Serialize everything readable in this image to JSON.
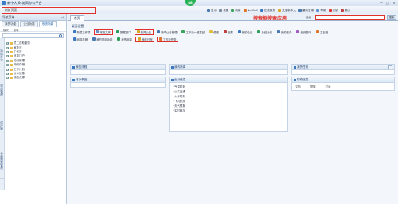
{
  "window": {
    "title": "新中大i6s协同办公平台",
    "badge": "48",
    "controls": [
      "—",
      "□",
      "×"
    ]
  },
  "top_hint": "刷新页面",
  "toolbar": {
    "items": [
      {
        "label": "显示",
        "color": "#4a78b3"
      },
      {
        "label": "设置",
        "color": "#7a8aa0"
      },
      {
        "label": "刷新",
        "color": "#3aa55a"
      },
      {
        "label": "NetCall",
        "color": "#e0742a"
      },
      {
        "label": "在线服务",
        "color": "#3a78c4"
      },
      {
        "label": "关注新中大",
        "color": "#d9a520"
      },
      {
        "label": "重新登录",
        "color": "#4a78b3"
      },
      {
        "label": "帮助",
        "color": "#5a8fd0"
      },
      {
        "label": "注销",
        "color": "#e0302a"
      },
      {
        "label": "退出",
        "color": "#c04040"
      }
    ]
  },
  "search": {
    "note": "搜索框搜索应用",
    "label": "检索",
    "button": "搜索",
    "value": ""
  },
  "left_panel": {
    "title": "导航菜单",
    "pin": "⊣",
    "tabs": [
      "我的功能",
      "企业功能",
      "系统功能"
    ],
    "active_tab": "系统功能",
    "subtabs": [
      "模块",
      "菜单"
    ],
    "vertical_tabs": [
      "协同办公",
      "项目管理",
      "供应链",
      "全面预算管理"
    ],
    "tree": [
      {
        "toggle": "+",
        "label": "员工自助服务"
      },
      {
        "toggle": "+",
        "label": "审批流"
      },
      {
        "toggle": "+",
        "label": "工作流"
      },
      {
        "toggle": "+",
        "label": "信息门户"
      },
      {
        "toggle": "+",
        "label": "知识管理"
      },
      {
        "toggle": "+",
        "label": "网络存储"
      },
      {
        "toggle": "+",
        "label": "工作计划"
      },
      {
        "toggle": "+",
        "label": "公众信息"
      },
      {
        "toggle": "+",
        "label": "我的资源"
      }
    ]
  },
  "main": {
    "tab": "首页",
    "desk_title": "桌面设置",
    "row1": [
      {
        "label": "新建工作项",
        "color": "#3a78c4",
        "boxed": false
      },
      {
        "label": "常用文库",
        "color": "#6b8fc7",
        "boxed": true
      },
      {
        "label": "数据窗口",
        "color": "#2f9e5a",
        "boxed": false
      },
      {
        "label": "新闻公告",
        "color": "#d9a520",
        "boxed": true
      },
      {
        "label": "新闻公告管理",
        "color": "#4a78b3",
        "boxed": false
      },
      {
        "label": "工作流一键发起",
        "color": "#3aa55a",
        "boxed": false
      },
      {
        "label": "便签",
        "color": "#e0c040",
        "boxed": false
      },
      {
        "label": "投票",
        "color": "#c04040",
        "boxed": false
      },
      {
        "label": "我的会议",
        "color": "#3a78c4",
        "boxed": false
      },
      {
        "label": "总结计划",
        "color": "#2f9e5a",
        "boxed": false
      },
      {
        "label": "我的任务",
        "color": "#4a78b3",
        "boxed": false
      },
      {
        "label": "借阅图书",
        "color": "#a05ac0",
        "boxed": false
      },
      {
        "label": "主日程",
        "color": "#e0742a",
        "boxed": false
      }
    ],
    "row2": [
      {
        "label": "网络存储",
        "color": "#3a78c4",
        "boxed": false
      },
      {
        "label": "我的常用功能",
        "color": "#4a78b3",
        "boxed": false
      },
      {
        "label": "我的网站",
        "color": "#2f9e5a",
        "boxed": false
      },
      {
        "label": "我的日程",
        "color": "#d9a520",
        "boxed": true
      },
      {
        "label": "工作流任务",
        "color": "#e0742a",
        "boxed": true
      }
    ],
    "portals": {
      "my_workflow": {
        "title": "我的流程"
      },
      "my_news": {
        "title": "我的新闻"
      },
      "my_tasks": {
        "title": "我的任务"
      },
      "pending": {
        "title": "待办事宜"
      },
      "travel": {
        "title": "出行信息",
        "items": [
          "气温时刻",
          "公共交通",
          "火车时刻",
          "飞机航班",
          "天气预报",
          "实时路况"
        ]
      },
      "attachments": {
        "title": "附件信息",
        "cols": [
          "文档",
          "提醒",
          "时间"
        ]
      }
    }
  }
}
